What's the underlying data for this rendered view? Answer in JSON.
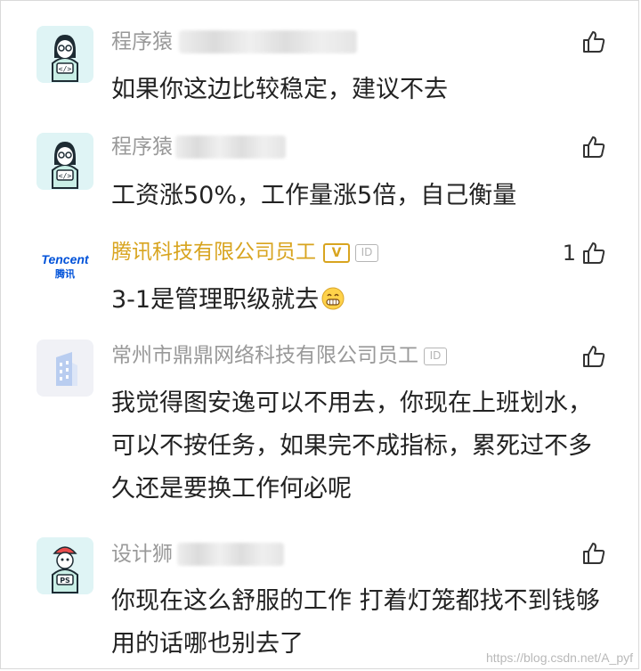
{
  "comments": [
    {
      "author": "程序猿",
      "text": "如果你这边比较稳定，建议不去",
      "like_count": ""
    },
    {
      "author": "程序猿",
      "text": "工资涨50%，工作量涨5倍，自己衡量",
      "like_count": ""
    },
    {
      "author": "腾讯科技有限公司员工",
      "text": "3-1是管理职级就去",
      "like_count": "1",
      "verified_badge": "V",
      "id_badge": "ID",
      "emoji": "grinning-face"
    },
    {
      "author": "常州市鼎鼎网络科技有限公司员工",
      "text": "我觉得图安逸可以不用去，你现在上班划水，可以不按任务，如果完不成指标，累死过不多久还是要换工作何必呢",
      "like_count": "",
      "id_badge": "ID"
    },
    {
      "author": "设计狮",
      "text": "你现在这么舒服的工作 打着灯笼都找不到钱够用的话哪也别去了",
      "like_count": ""
    }
  ],
  "logos": {
    "tencent_en": "Tencent",
    "tencent_cn": "腾讯"
  },
  "avatar_text": {
    "code": "</>",
    "ps": "PS"
  },
  "watermark": "https://blog.csdn.net/A_pyf",
  "colors": {
    "gold": "#d8a41f",
    "name_gray": "#999999",
    "text": "#222222",
    "avatar_teal": "#dff4f5"
  }
}
